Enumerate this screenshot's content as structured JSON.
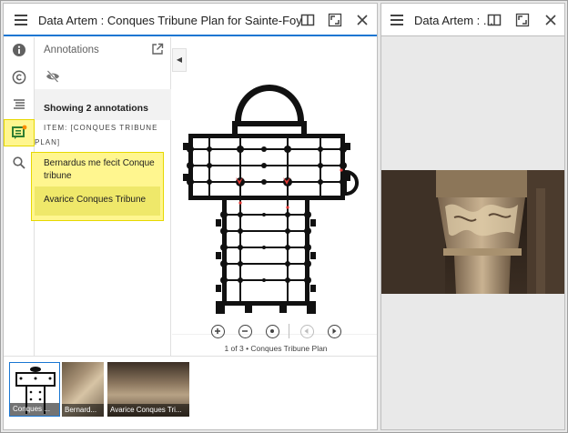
{
  "left_window": {
    "title": "Data Artem : Conques Tribune Plan for Sainte-Foy",
    "panel": {
      "heading": "Annotations",
      "showing": "Showing 2 annotations",
      "item_label_line1": "ITEM: [CONQUES TRIBUNE",
      "item_label_line2": "PLAN]",
      "annotations": [
        "Bernardus me fecit Conque tribune",
        "Avarice Conques Tribune"
      ]
    },
    "viewer": {
      "caption": "1 of 3 • Conques Tribune Plan"
    },
    "thumbnails": [
      "Conques ...",
      "Bernard...",
      "Avarice Conques Tri..."
    ]
  },
  "right_window": {
    "title": "Data Artem : ..."
  },
  "colors": {
    "accent": "#1976d2",
    "highlight": "#fff68f",
    "annotation_marker": "#e53935"
  },
  "icons": {
    "rail": [
      "info-icon",
      "copyright-icon",
      "list-icon",
      "annotations-icon",
      "search-icon"
    ],
    "window": [
      "menu-icon",
      "split-view-icon",
      "fullscreen-icon",
      "close-icon"
    ]
  }
}
